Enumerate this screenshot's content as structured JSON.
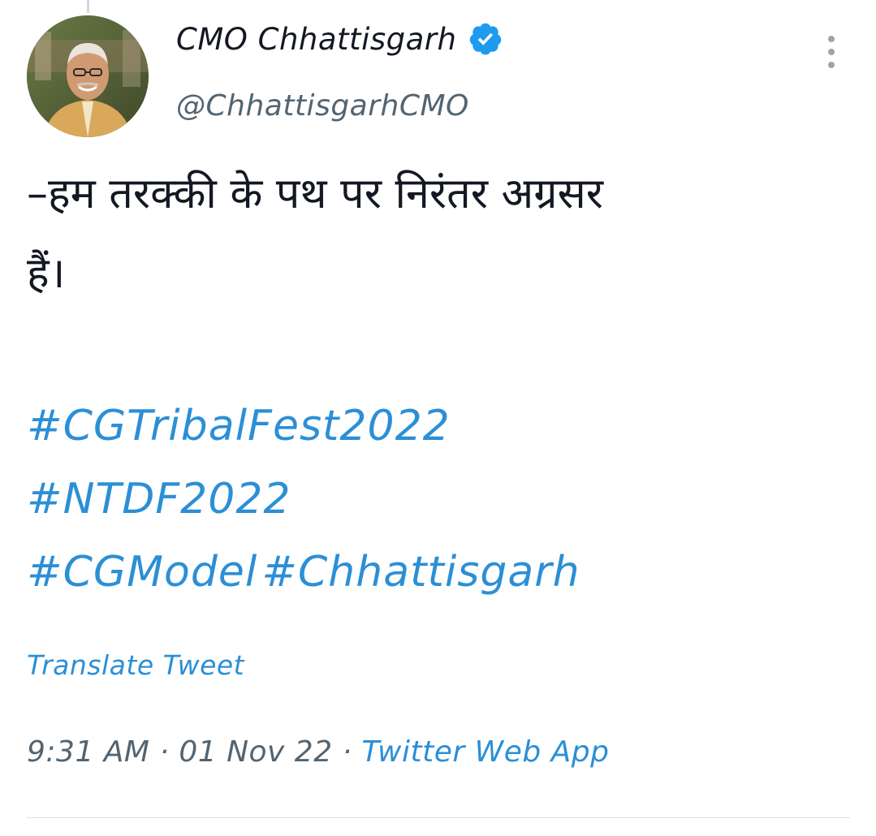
{
  "tweet": {
    "author": {
      "display_name": "CMO Chhattisgarh",
      "handle": "@ChhattisgarhCMO",
      "verified_icon": "verified-badge-icon"
    },
    "text_lines": [
      "–हम तरक्की के पथ पर निरंतर अग्रसर",
      "हैं।"
    ],
    "hashtags": [
      "#CGTribalFest2022",
      "#NTDF2022",
      "#CGModel",
      "#Chhattisgarh"
    ],
    "translate_label": "Translate Tweet",
    "time": "9:31 AM",
    "separator": "·",
    "date": "01 Nov 22",
    "source": "Twitter Web App"
  },
  "more_icon": "more-vertical-icon",
  "colors": {
    "link": "#2b8fd6",
    "verified": "#1d9bf0",
    "text": "#141823",
    "muted": "#536471"
  }
}
